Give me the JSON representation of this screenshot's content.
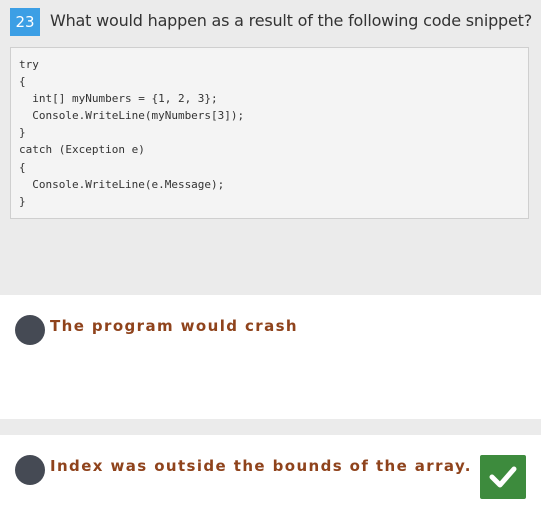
{
  "question": {
    "number": "23",
    "text": "What would happen as a result of the following code snippet?",
    "code_lines": [
      "try",
      "{",
      "  int[] myNumbers = {1, 2, 3};",
      "  Console.WriteLine(myNumbers[3]);",
      "}",
      "catch (Exception e)",
      "{",
      "  Console.WriteLine(e.Message);",
      "}"
    ]
  },
  "options": [
    {
      "label": "The program would crash",
      "correct": false
    },
    {
      "label": "Index was outside the bounds of the array.",
      "correct": true
    }
  ],
  "colors": {
    "accent": "#3c9fe5",
    "answer_text": "#8f431c",
    "radio": "#454a54",
    "correct": "#3d8b3d"
  },
  "icons": {
    "correct_marker": "checkmark-icon"
  }
}
